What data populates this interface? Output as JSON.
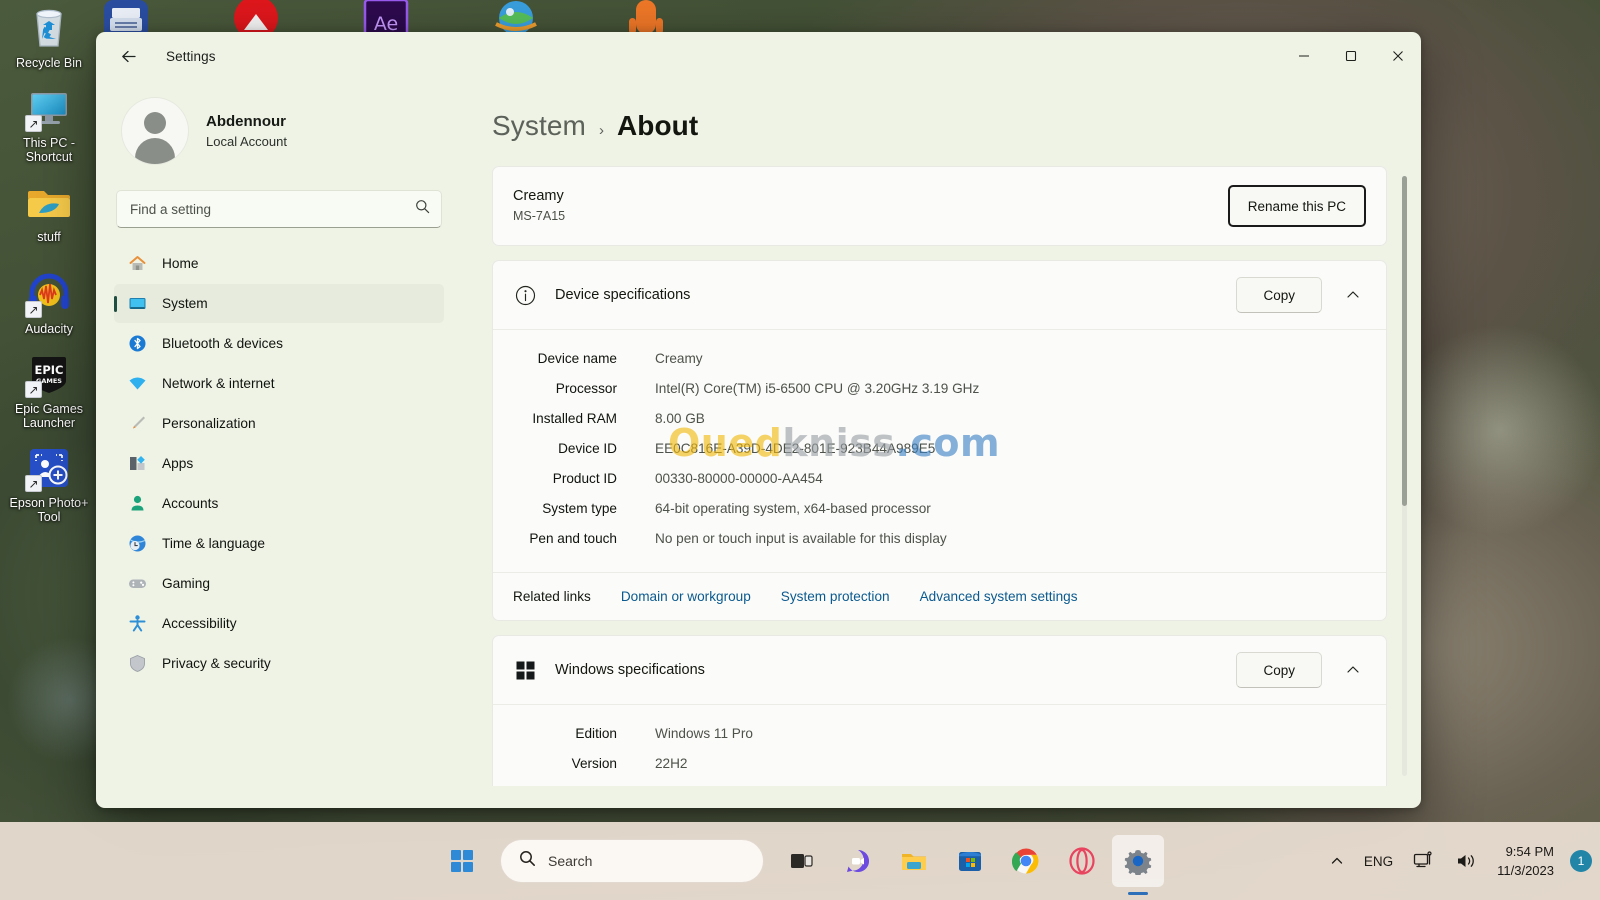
{
  "desktop": {
    "icons": [
      {
        "label": "Recycle Bin",
        "icon": "recycle-bin-icon",
        "shortcut": false
      },
      {
        "label": "This PC - Shortcut",
        "icon": "this-pc-icon",
        "shortcut": true
      },
      {
        "label": "stuff",
        "icon": "folder-icon",
        "shortcut": false
      },
      {
        "label": "Audacity",
        "icon": "audacity-icon",
        "shortcut": true
      },
      {
        "label": "Epic Games Launcher",
        "icon": "epic-games-icon",
        "shortcut": true
      },
      {
        "label": "Epson Photo+ Tool",
        "icon": "epson-photo-tool-icon",
        "shortcut": true
      }
    ]
  },
  "window": {
    "app_title": "Settings",
    "back_label": "Back",
    "controls": {
      "minimize": "Minimize",
      "maximize": "Maximize",
      "close": "Close"
    }
  },
  "sidebar": {
    "account": {
      "name": "Abdennour",
      "type": "Local Account",
      "avatar": "user-avatar"
    },
    "search": {
      "placeholder": "Find a setting",
      "value": ""
    },
    "items": [
      {
        "label": "Home",
        "icon": "home-icon",
        "active": false
      },
      {
        "label": "System",
        "icon": "system-icon",
        "active": true
      },
      {
        "label": "Bluetooth & devices",
        "icon": "bluetooth-icon",
        "active": false
      },
      {
        "label": "Network & internet",
        "icon": "network-icon",
        "active": false
      },
      {
        "label": "Personalization",
        "icon": "personalization-icon",
        "active": false
      },
      {
        "label": "Apps",
        "icon": "apps-icon",
        "active": false
      },
      {
        "label": "Accounts",
        "icon": "accounts-icon",
        "active": false
      },
      {
        "label": "Time & language",
        "icon": "time-language-icon",
        "active": false
      },
      {
        "label": "Gaming",
        "icon": "gaming-icon",
        "active": false
      },
      {
        "label": "Accessibility",
        "icon": "accessibility-icon",
        "active": false
      },
      {
        "label": "Privacy & security",
        "icon": "privacy-security-icon",
        "active": false
      }
    ]
  },
  "breadcrumb": {
    "parent": "System",
    "separator": "›",
    "current": "About"
  },
  "pc_card": {
    "name": "Creamy",
    "model": "MS-7A15",
    "rename_button": "Rename this PC"
  },
  "device_specs": {
    "title": "Device specifications",
    "icon": "info-icon",
    "copy_button": "Copy",
    "collapse_icon": "chevron-up-icon",
    "rows": [
      {
        "key": "Device name",
        "value": "Creamy"
      },
      {
        "key": "Processor",
        "value": "Intel(R) Core(TM) i5-6500 CPU @ 3.20GHz   3.19 GHz"
      },
      {
        "key": "Installed RAM",
        "value": "8.00 GB"
      },
      {
        "key": "Device ID",
        "value": "EE0C816E-A39D-4DE2-801E-923B44A989E5"
      },
      {
        "key": "Product ID",
        "value": "00330-80000-00000-AA454"
      },
      {
        "key": "System type",
        "value": "64-bit operating system, x64-based processor"
      },
      {
        "key": "Pen and touch",
        "value": "No pen or touch input is available for this display"
      }
    ],
    "related_links_label": "Related links",
    "related_links": [
      "Domain or workgroup",
      "System protection",
      "Advanced system settings"
    ]
  },
  "windows_specs": {
    "title": "Windows specifications",
    "icon": "windows-logo-icon",
    "copy_button": "Copy",
    "collapse_icon": "chevron-up-icon",
    "rows": [
      {
        "key": "Edition",
        "value": "Windows 11 Pro"
      },
      {
        "key": "Version",
        "value": "22H2"
      }
    ]
  },
  "watermark": {
    "part1": "Oued",
    "part2": "kniss",
    "part3": ".com"
  },
  "taskbar": {
    "start": "Start",
    "search": {
      "placeholder": "Search",
      "icon": "search-icon"
    },
    "apps": [
      {
        "name": "task-view-icon",
        "label": "Task View"
      },
      {
        "name": "chat-icon",
        "label": "Chat"
      },
      {
        "name": "file-explorer-icon",
        "label": "File Explorer"
      },
      {
        "name": "microsoft-store-icon",
        "label": "Microsoft Store"
      },
      {
        "name": "chrome-icon",
        "label": "Google Chrome"
      },
      {
        "name": "opera-gx-icon",
        "label": "Opera GX"
      },
      {
        "name": "settings-icon",
        "label": "Settings"
      }
    ],
    "tray": {
      "overflow_icon": "chevron-up-icon",
      "language": "ENG",
      "network_icon": "network-tray-icon",
      "volume_icon": "volume-icon",
      "time": "9:54 PM",
      "date": "11/3/2023",
      "notification_count": "1"
    }
  },
  "colors": {
    "window_bg": "#eff3e6",
    "card_bg": "#fbfbf9",
    "accent": "#1f4f42",
    "link": "#0b5a8f",
    "taskbar_bg": "#eee2d6",
    "badge": "#2185a8"
  }
}
